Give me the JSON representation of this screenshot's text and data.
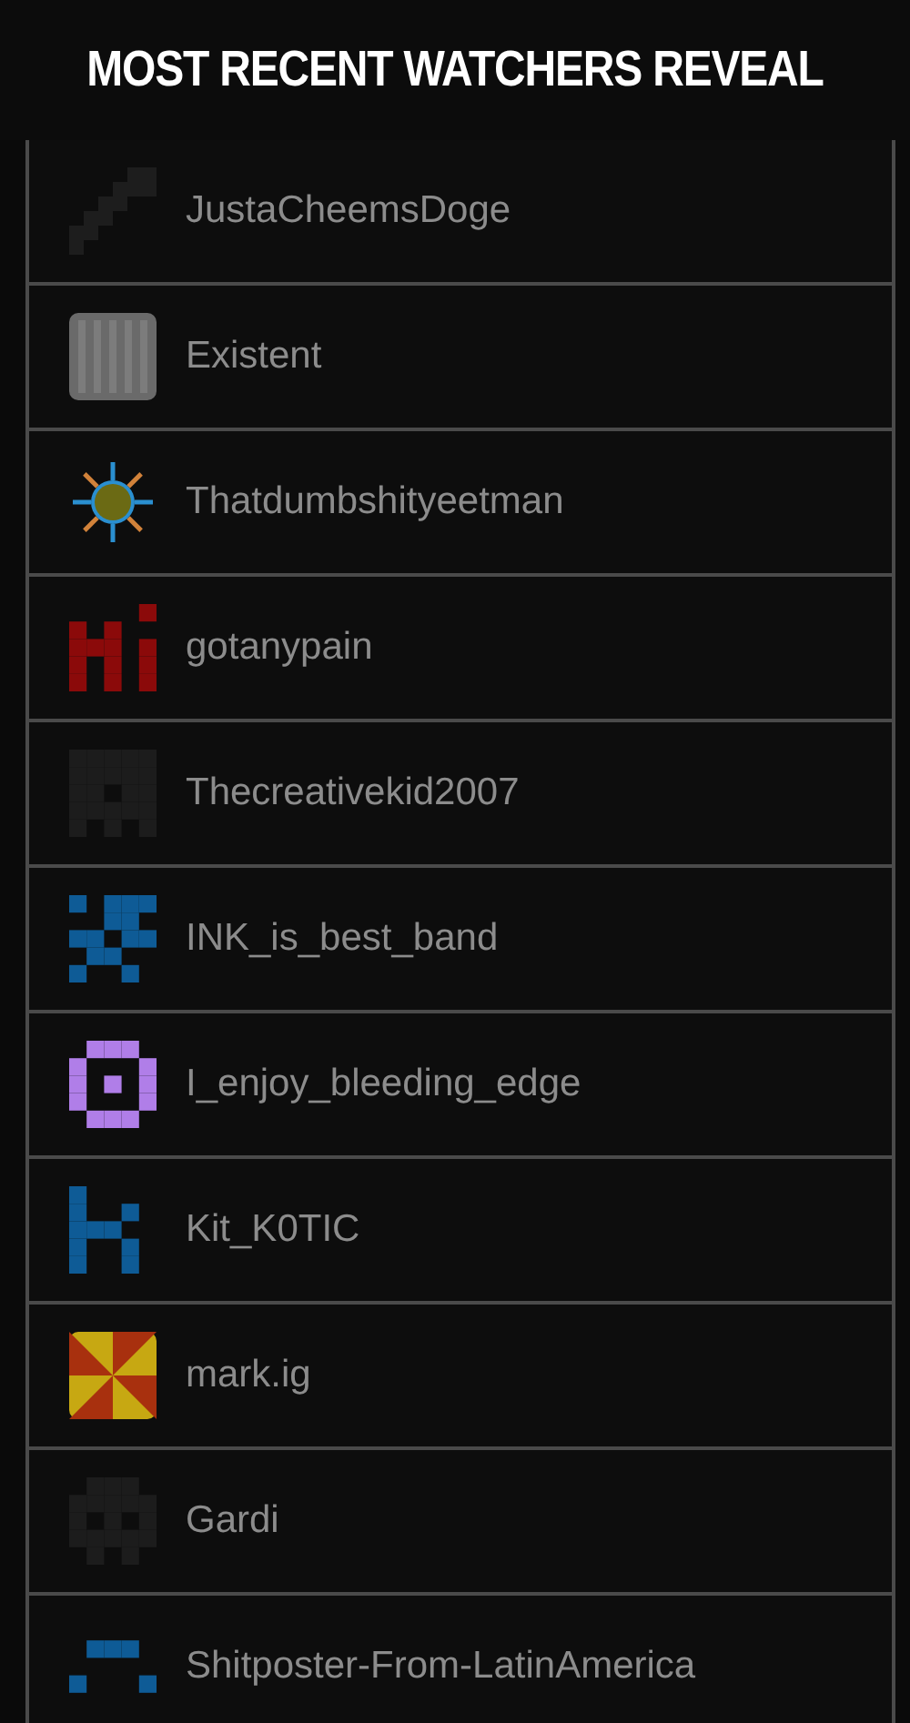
{
  "caption": "MOST RECENT WATCHERS REVEAL",
  "watchers": [
    {
      "username": "JustaCheemsDoge"
    },
    {
      "username": "Existent"
    },
    {
      "username": "Thatdumbshityeetman"
    },
    {
      "username": "gotanypain"
    },
    {
      "username": "Thecreativekid2007"
    },
    {
      "username": "INK_is_best_band"
    },
    {
      "username": "I_enjoy_bleeding_edge"
    },
    {
      "username": "Kit_K0TIC"
    },
    {
      "username": "mark.ig"
    },
    {
      "username": "Gardi"
    },
    {
      "username": "Shitposter-From-LatinAmerica"
    }
  ]
}
